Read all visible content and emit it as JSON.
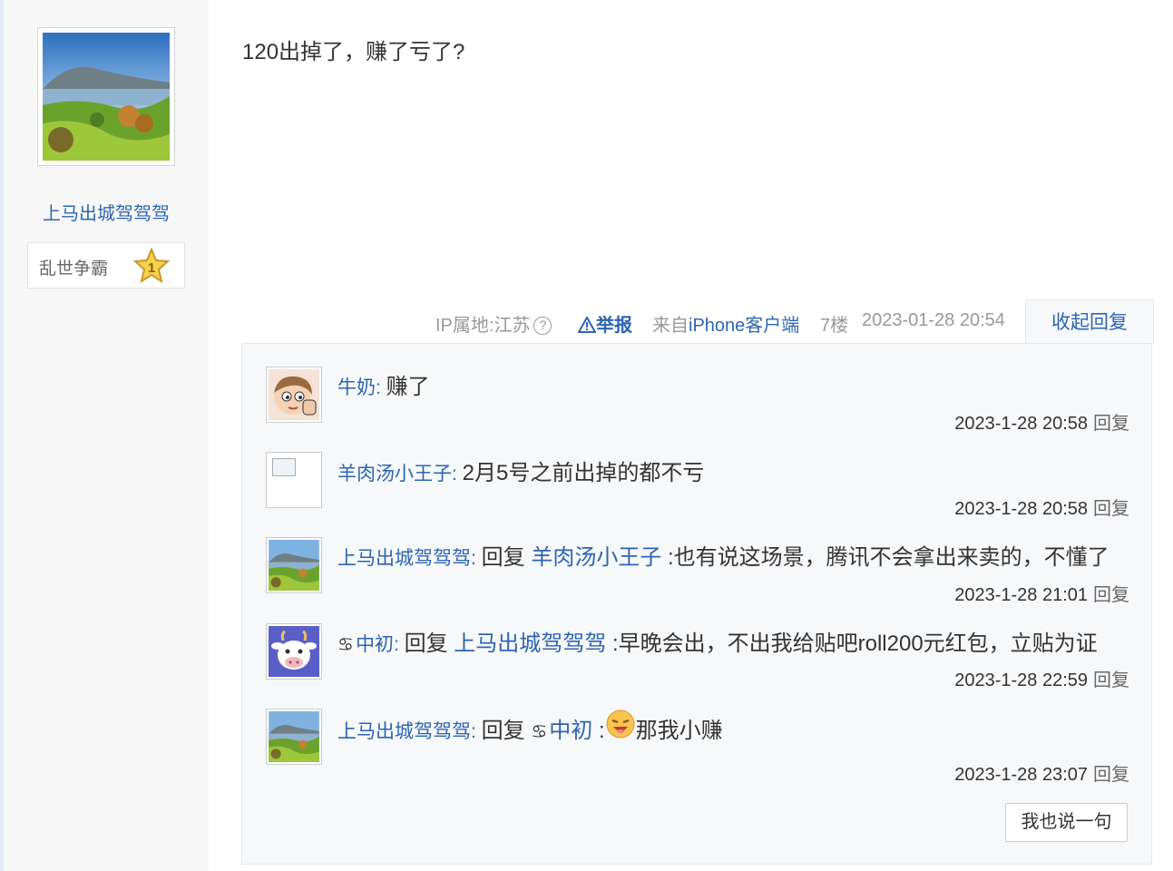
{
  "author": {
    "username": "上马出城驾驾驾",
    "level_name": "乱世争霸",
    "level": "1"
  },
  "post": {
    "content": "120出掉了，赚了亏了?",
    "ip": "IP属地:江苏",
    "help_icon": "?",
    "report": "举报",
    "from_prefix": "来自",
    "from_client": "iPhone客户端",
    "floor": "7楼",
    "time": "2023-01-28 20:54",
    "collapse": "收起回复"
  },
  "replies": [
    {
      "user": "牛奶",
      "sep": ": ",
      "text": "赚了",
      "time": "2023-1-28 20:58",
      "reply_label": "回复",
      "avatar": "cartoon-kid-avatar"
    },
    {
      "user": "羊肉汤小王子",
      "sep": ": ",
      "text": "2月5号之前出掉的都不亏",
      "time": "2023-1-28 20:58",
      "reply_label": "回复",
      "avatar": "broken-image-avatar"
    },
    {
      "user": "上马出城驾驾驾",
      "sep": ": ",
      "reply_word": "回复 ",
      "target": "羊肉汤小王子",
      "text": " :也有说这场景，腾讯不会拿出来卖的，不懂了",
      "time": "2023-1-28 21:01",
      "reply_label": "回复",
      "avatar": "landscape-avatar"
    },
    {
      "user_icon": "♋",
      "user": "中初",
      "sep": ": ",
      "reply_word": "回复 ",
      "target": "上马出城驾驾驾",
      "text": " :早晚会出，不出我给贴吧roll200元红包，立贴为证",
      "time": "2023-1-28 22:59",
      "reply_label": "回复",
      "avatar": "cow-avatar"
    },
    {
      "user": "上马出城驾驾驾",
      "sep": ": ",
      "reply_word": "回复 ",
      "target_icon": "♋",
      "target": "中初",
      "colon": " :",
      "text": "那我小赚",
      "time": "2023-1-28 23:07",
      "reply_label": "回复",
      "avatar": "landscape-avatar"
    }
  ],
  "say_button": "我也说一句",
  "colors": {
    "link": "#2d64b3",
    "sidebar_bg": "#f7f7f7",
    "reply_bg": "#f7f8fa"
  }
}
